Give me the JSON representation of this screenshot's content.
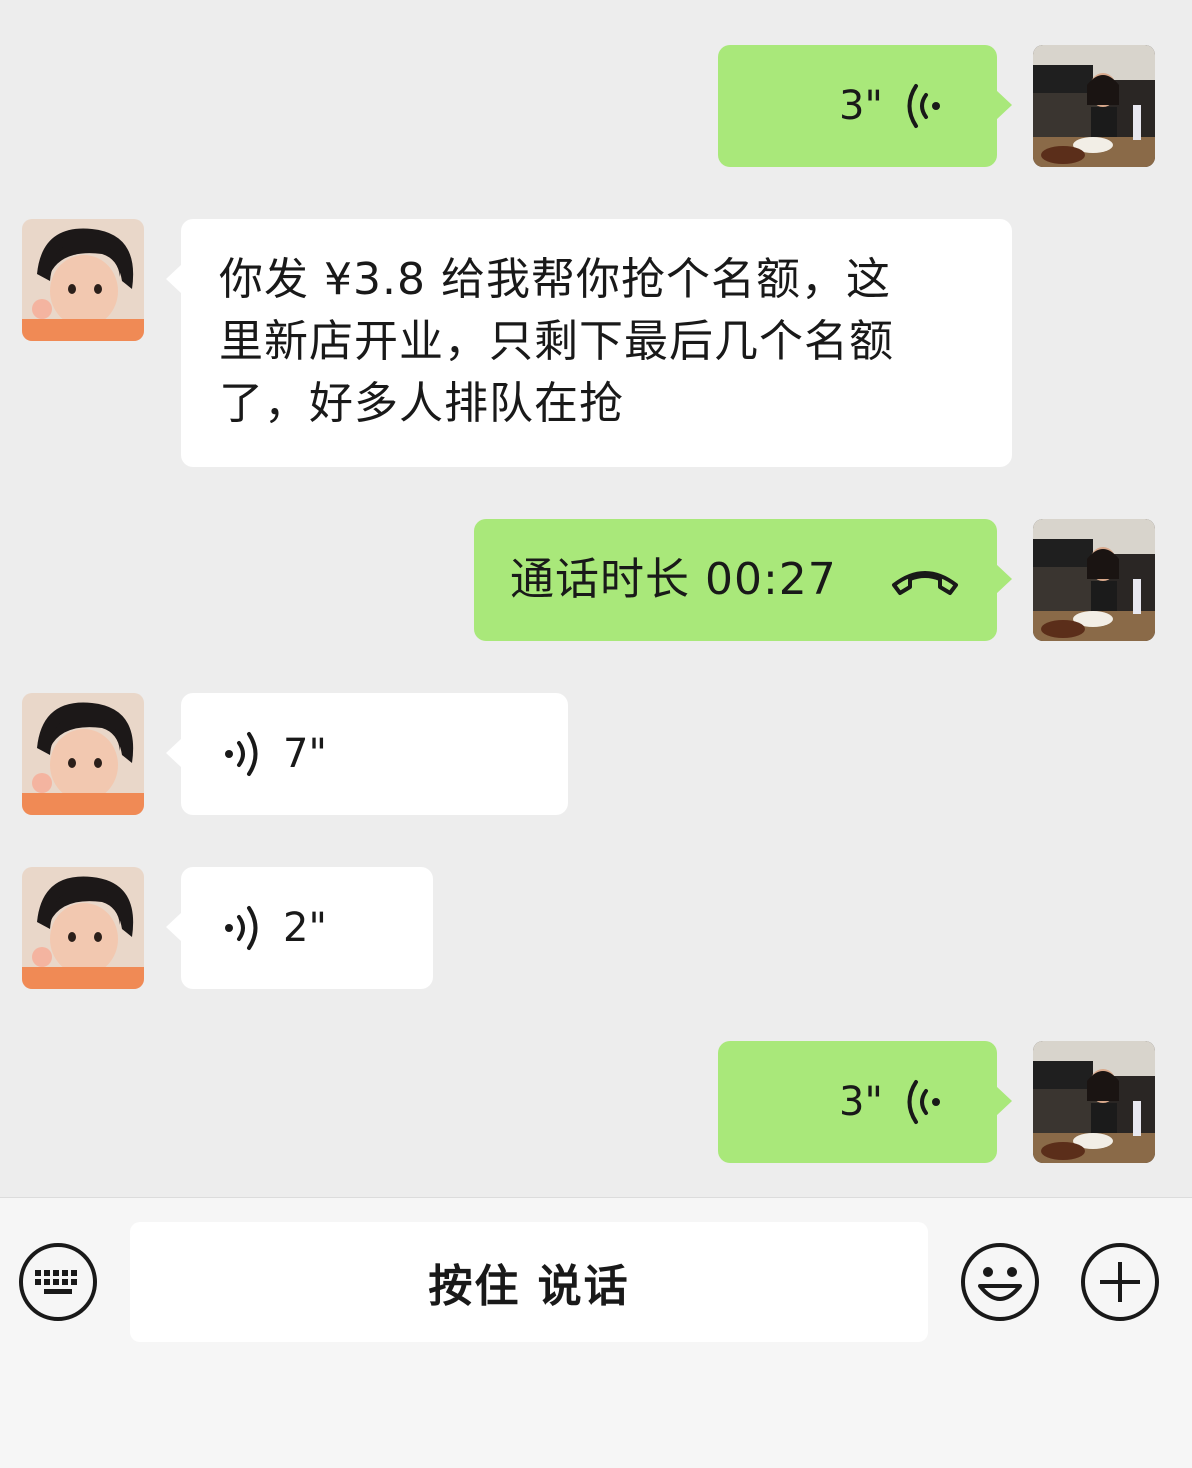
{
  "messages": [
    {
      "from": "me",
      "type": "voice",
      "duration": "3\""
    },
    {
      "from": "them",
      "type": "text",
      "lines": [
        "你发 ¥3.8 给我帮你抢个名额，这",
        "里新店开业，只剩下最后几个名额",
        "了，好多人排队在抢"
      ]
    },
    {
      "from": "me",
      "type": "call",
      "label": "通话时长 00:27"
    },
    {
      "from": "them",
      "type": "voice",
      "duration": "7\""
    },
    {
      "from": "them",
      "type": "voice",
      "duration": "2\""
    },
    {
      "from": "me",
      "type": "voice",
      "duration": "3\""
    }
  ],
  "input_bar": {
    "hold_to_talk_label": "按住 说话",
    "left_icon": "keyboard-icon",
    "emoji_icon": "smiley-icon",
    "plus_icon": "plus-icon"
  },
  "colors": {
    "background": "#ededed",
    "my_bubble": "#a9e87a",
    "their_bubble": "#ffffff",
    "bottom_bar": "#f6f6f6"
  }
}
